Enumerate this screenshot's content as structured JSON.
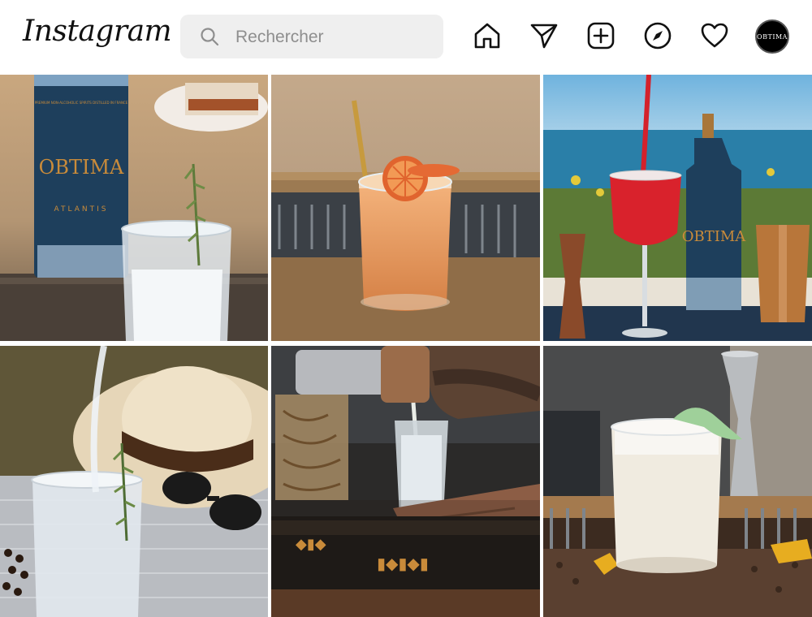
{
  "header": {
    "logo_text": "Instagram",
    "search_placeholder": "Rechercher",
    "nav_icons": [
      "home-icon",
      "direct-message-icon",
      "new-post-icon",
      "explore-icon",
      "activity-heart-icon"
    ],
    "avatar_text": "OBTIMA"
  },
  "posts": [
    {
      "label_bottle": "OBTIMA",
      "label_sub": "ATLANTIS",
      "label_small": "PREMIUM NON-ALCOHOLIC SPIRITS DISTILLED IN FRANCE"
    },
    {
      "label": ""
    },
    {
      "label_bottle": "OBTIMA"
    },
    {
      "label": ""
    },
    {
      "label": ""
    },
    {
      "label": ""
    }
  ],
  "colors": {
    "bottle_blue": "#1e3f5c",
    "copper": "#b8763a",
    "brand_gold": "#c98b3a"
  }
}
